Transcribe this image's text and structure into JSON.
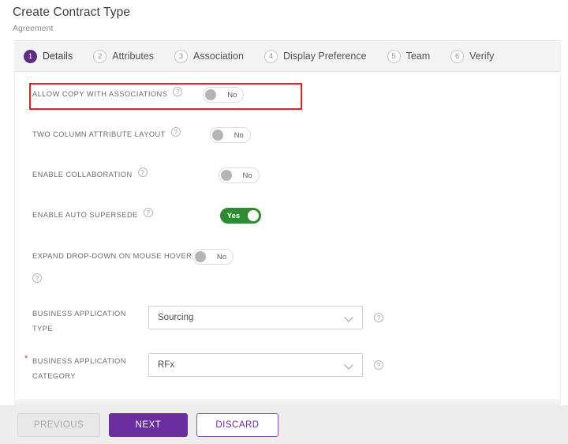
{
  "header": {
    "title": "Create Contract Type",
    "subtitle": "Agreement"
  },
  "steps": [
    {
      "number": "1",
      "label": "Details",
      "active": true
    },
    {
      "number": "2",
      "label": "Attributes",
      "active": false
    },
    {
      "number": "3",
      "label": "Association",
      "active": false
    },
    {
      "number": "4",
      "label": "Display Preference",
      "active": false
    },
    {
      "number": "5",
      "label": "Team",
      "active": false
    },
    {
      "number": "6",
      "label": "Verify",
      "active": false
    }
  ],
  "icons": {
    "help": "?",
    "chevron_down": "chevron-down-icon"
  },
  "form": {
    "toggles": [
      {
        "label": "ALLOW COPY WITH ASSOCIATIONS",
        "value": "No",
        "state": "off",
        "highlighted": true
      },
      {
        "label": "TWO COLUMN ATTRIBUTE LAYOUT",
        "value": "No",
        "state": "off",
        "highlighted": false
      },
      {
        "label": "ENABLE COLLABORATION",
        "value": "No",
        "state": "off",
        "highlighted": false
      },
      {
        "label": "ENABLE AUTO SUPERSEDE",
        "value": "Yes",
        "state": "on",
        "highlighted": false
      },
      {
        "label": "EXPAND DROP-DOWN ON MOUSE HOVER",
        "value": "No",
        "state": "off",
        "highlighted": false
      }
    ],
    "selects": [
      {
        "label": "BUSINESS APPLICATION TYPE",
        "value": "Sourcing",
        "required": false
      },
      {
        "label": "BUSINESS APPLICATION CATEGORY",
        "value": "RFx",
        "required": true
      }
    ]
  },
  "footer": {
    "previous_label": "PREVIOUS",
    "next_label": "NEXT",
    "discard_label": "DISCARD"
  },
  "colors": {
    "accent_purple": "#6b2e9e",
    "step_active": "#5c2d83",
    "toggle_on_green": "#2e8b31",
    "required_red": "#e8352b",
    "highlight_red": "#ee1c1c"
  }
}
